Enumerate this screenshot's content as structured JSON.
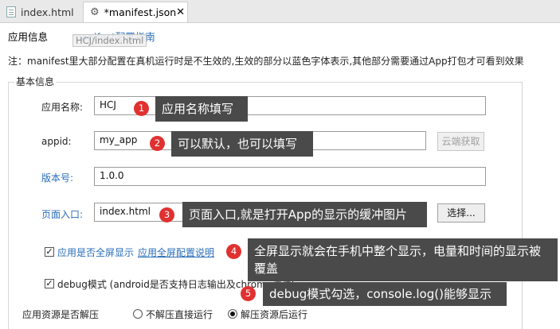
{
  "tabs": [
    {
      "label": "index.html"
    },
    {
      "label": "*manifest.json",
      "close": "✕"
    }
  ],
  "subnav": {
    "tab_app_info": "应用信息",
    "tab_guide": "manifest配置指南",
    "ghost_tooltip": "HCJ/index.html"
  },
  "note": "注：manifest里大部分配置在真机运行时是不生效的,生效的部分以蓝色字体表示,其他部分需要通过App打包才可看到效果",
  "section_title": "基本信息",
  "form": {
    "app_name_label": "应用名称:",
    "app_name_value": "HCJ",
    "appid_label": "appid:",
    "appid_value": "my_app",
    "cloud_btn": "云端获取",
    "version_label": "版本号:",
    "version_value": "1.0.0",
    "entry_label": "页面入口:",
    "entry_value": "index.html",
    "choose_btn": "选择...",
    "fullscreen_label": "应用是否全屏显示",
    "fullscreen_link": "应用全屏配置说明",
    "fullscreen_checked": true,
    "debug_label": "debug模式 (android是否支持日志输出及chrome调试)",
    "debug_checked": true,
    "unzip_label": "应用资源是否解压",
    "unzip_options": [
      "不解压直接运行",
      "解压资源后运行"
    ],
    "unzip_selected": 1
  },
  "annotations": [
    {
      "num": "1",
      "text": "应用名称填写"
    },
    {
      "num": "2",
      "text": "可以默认，也可以填写"
    },
    {
      "num": "3",
      "text": "页面入口,就是打开App的显示的缓冲图片"
    },
    {
      "num": "4",
      "text": "全屏显示就会在手机中整个显示，电量和时间的显示被覆盖"
    },
    {
      "num": "5",
      "text": "debug模式勾选，console.log()能够显示"
    }
  ],
  "colors": {
    "link_blue": "#2a6eb8",
    "badge_red": "#e03131",
    "tip_gray": "#4a4a4a"
  }
}
